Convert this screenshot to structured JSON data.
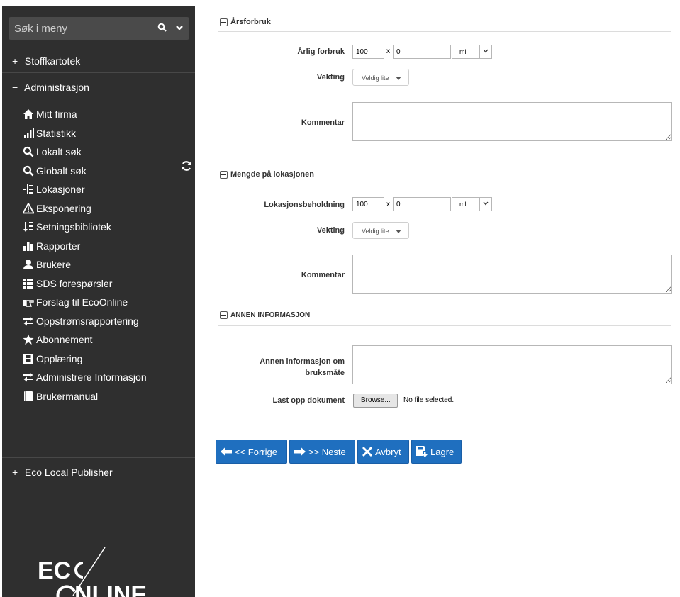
{
  "sidebar": {
    "search_placeholder": "Søk i meny",
    "sections": {
      "stoffkartotek": {
        "sign": "+",
        "label": "Stoffkartotek"
      },
      "administrasjon": {
        "sign": "−",
        "label": "Administrasjon"
      },
      "publisher": {
        "sign": "+",
        "label": "Eco Local Publisher"
      }
    },
    "items": [
      {
        "label": "Mitt firma",
        "icon": "home-icon"
      },
      {
        "label": "Statistikk",
        "icon": "signal-bars-icon"
      },
      {
        "label": "Lokalt søk",
        "icon": "search-icon"
      },
      {
        "label": "Globalt søk",
        "icon": "search-icon"
      },
      {
        "label": "Lokasjoner",
        "icon": "tree-icon"
      },
      {
        "label": "Eksponering",
        "icon": "warning-icon"
      },
      {
        "label": "Setningsbibliotek",
        "icon": "sort-icon"
      },
      {
        "label": "Rapporter",
        "icon": "bar-chart-icon"
      },
      {
        "label": "Brukere",
        "icon": "user-icon"
      },
      {
        "label": "SDS forespørsler",
        "icon": "list-icon"
      },
      {
        "label": "Forslag til EcoOnline",
        "icon": "hand-pointer-icon"
      },
      {
        "label": "Oppstrømsrapportering",
        "icon": "exchange-icon"
      },
      {
        "label": "Abonnement",
        "icon": "star-icon"
      },
      {
        "label": "Opplæring",
        "icon": "film-icon"
      },
      {
        "label": "Administrere Informasjon",
        "icon": "exchange-icon"
      },
      {
        "label": "Brukermanual",
        "icon": "book-icon"
      }
    ],
    "logo_text": "ECOONLINE"
  },
  "form": {
    "sec1": {
      "title": "Årsforbruk",
      "annual_label": "Årlig forbruk",
      "amount": "100",
      "x": "x",
      "factor": "0",
      "unit": "ml",
      "weight_label": "Vekting",
      "weight_value": "Veldig lite",
      "comment_label": "Kommentar"
    },
    "sec2": {
      "title": "Mengde på lokasjonen",
      "stock_label": "Lokasjonsbeholdning",
      "amount": "100",
      "x": "x",
      "factor": "0",
      "unit": "ml",
      "weight_label": "Vekting",
      "weight_value": "Veldig lite",
      "comment_label": "Kommentar"
    },
    "sec3": {
      "title": "ANNEN INFORMASJON",
      "usage_label_1": "Annen informasjon om",
      "usage_label_2": "bruksmåte",
      "upload_label": "Last opp dokument",
      "browse_label": "Browse...",
      "no_file": "No file selected."
    },
    "buttons": {
      "prev": "<< Forrige",
      "next": ">> Neste",
      "cancel": "Avbryt",
      "save": "Lagre"
    }
  },
  "colors": {
    "sidebar_bg": "#2f2f2f",
    "button_blue": "#1f6fbf"
  }
}
